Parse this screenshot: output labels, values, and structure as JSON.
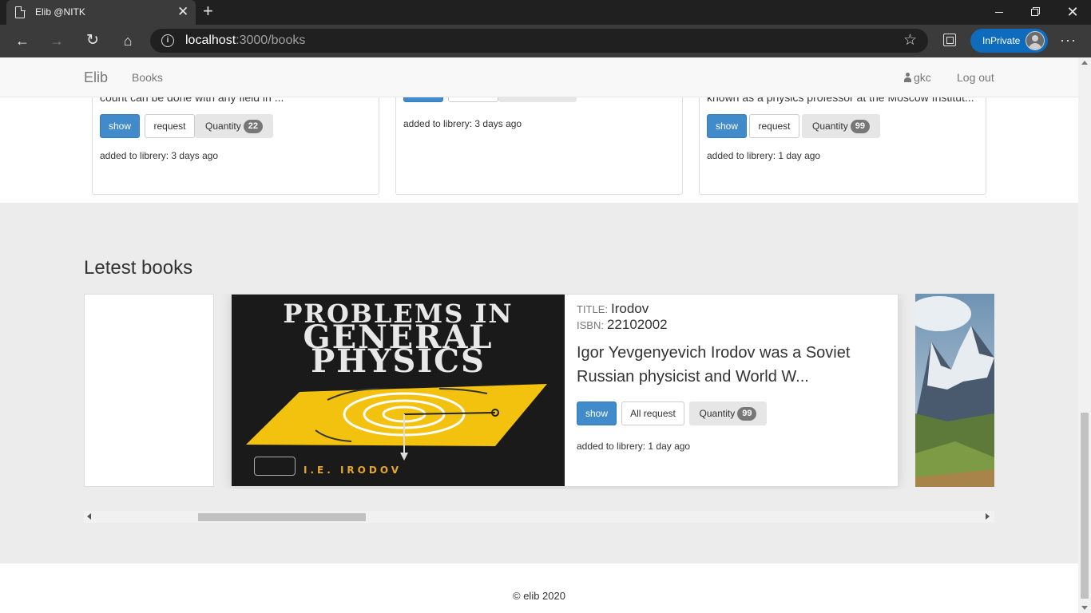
{
  "browser": {
    "tab_title": "Elib @NITK",
    "url_host": "localhost",
    "url_path": ":3000/books",
    "inprivate_label": "InPrivate"
  },
  "navbar": {
    "brand": "Elib",
    "books_link": "Books",
    "user": "gkc",
    "logout": "Log out"
  },
  "top_cards": [
    {
      "text": "count can be done with any field in ...",
      "show": "show",
      "request": "request",
      "quantity_label": "Quantity",
      "quantity": "22",
      "added": "added to librery: 3 days ago"
    },
    {
      "added": "added to librery: 3 days ago"
    },
    {
      "text": "known as a physics professor at the Moscow Institut...",
      "show": "show",
      "request": "request",
      "quantity_label": "Quantity",
      "quantity": "99",
      "added": "added to librery: 1 day ago"
    }
  ],
  "latest": {
    "heading": "Letest books",
    "book": {
      "title_label": "TITLE:",
      "title": "Irodov",
      "isbn_label": "ISBN:",
      "isbn": "22102002",
      "description": "Igor Yevgenyevich Irodov was a Soviet Russian physicist and World W...",
      "show": "show",
      "request": "All request",
      "quantity_label": "Quantity",
      "quantity": "99",
      "added": "added to librery: 1 day ago",
      "cover_line1": "PROBLEMS IN",
      "cover_line2": "GENERAL",
      "cover_line3": "PHYSICS",
      "cover_author": "I.E. IRODOV"
    }
  },
  "footer": {
    "text": "© elib 2020"
  },
  "colors": {
    "primary": "#428bca",
    "badge": "#777777",
    "section_bg": "#ececec",
    "inprivate": "#0f6cbd"
  }
}
